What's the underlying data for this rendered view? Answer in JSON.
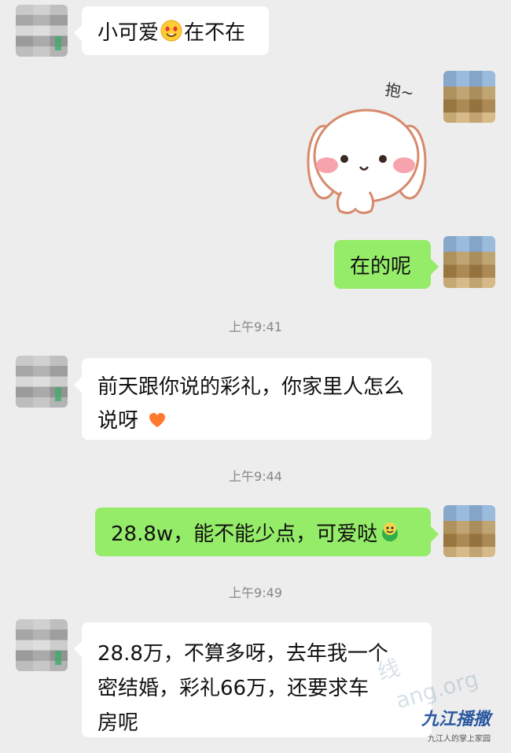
{
  "messages": {
    "m1": {
      "text_before": "小可爱",
      "text_after": "在不在"
    },
    "sticker_text": "抱~",
    "m2": {
      "text": "在的呢"
    },
    "time1": "上午9:41",
    "m3": {
      "line1": "前天跟你说的彩礼，你家里人怎么",
      "line2": "说呀"
    },
    "time2": "上午9:44",
    "m4": {
      "text": "28.8w，能不能少点，可爱哒"
    },
    "time3": "上午9:49",
    "m5": {
      "line1": "28.8万，不算多呀，去年我一个",
      "line2": "密结婚，彩礼66万，还要求车",
      "line3": "房呢"
    }
  },
  "watermark": {
    "text": "线",
    "text2": "ang.org"
  },
  "brand": {
    "title": "九江播撒",
    "subtitle": "九江人的掌上家园"
  },
  "colors": {
    "background": "#ededed",
    "my_bubble": "#95ec69",
    "friend_bubble": "#ffffff"
  },
  "icons": {
    "m1": "heart-eyes-emoji",
    "m3": "orange-heart-emoji",
    "m4": "green-frog-emoji"
  }
}
